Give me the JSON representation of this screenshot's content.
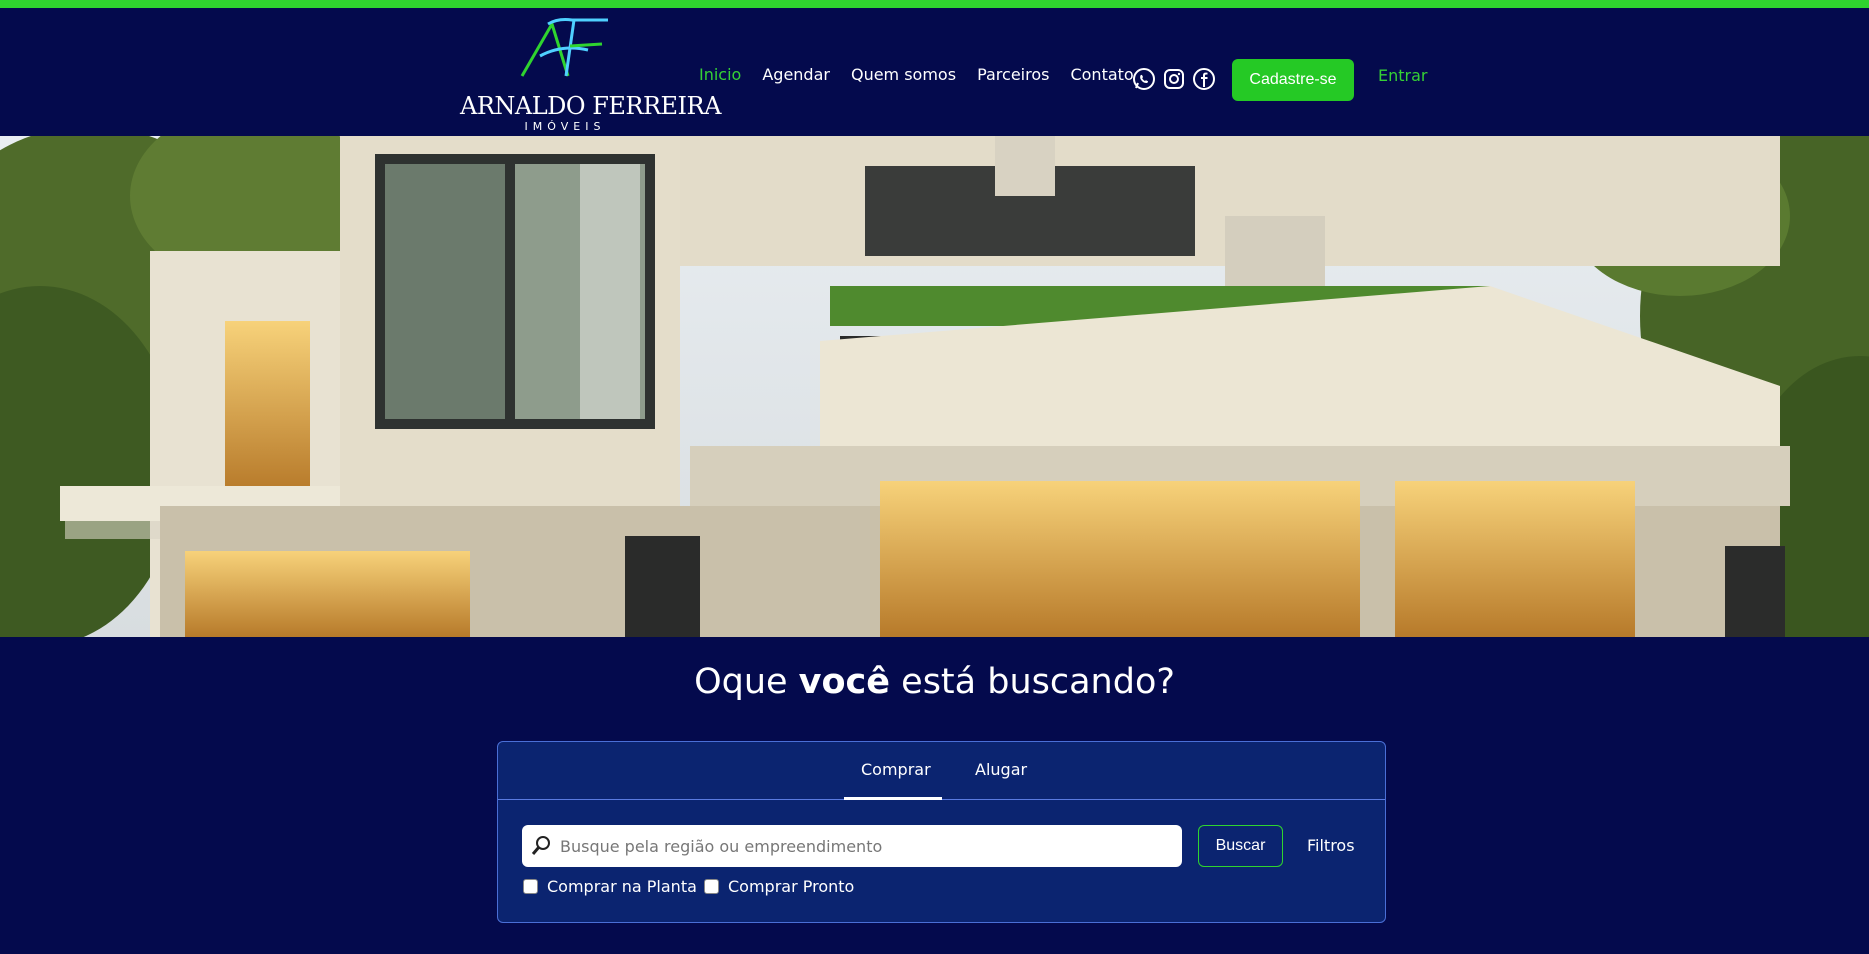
{
  "brand": {
    "name": "ARNALDO FERREIRA",
    "subtitle": "IMÓVEIS",
    "monogram": "AF"
  },
  "nav": {
    "items": [
      {
        "label": "Inicio",
        "active": true
      },
      {
        "label": "Agendar",
        "active": false
      },
      {
        "label": "Quem somos",
        "active": false
      },
      {
        "label": "Parceiros",
        "active": false
      },
      {
        "label": "Contato",
        "active": false
      }
    ],
    "socials": [
      "whatsapp-icon",
      "instagram-icon",
      "facebook-icon"
    ],
    "signup_label": "Cadastre-se",
    "login_label": "Entrar"
  },
  "hero": {
    "image": "modern-house-photo"
  },
  "search": {
    "headline_pre": "Oque ",
    "headline_bold": "você",
    "headline_post": " está buscando?",
    "tabs": [
      {
        "label": "Comprar",
        "active": true
      },
      {
        "label": "Alugar",
        "active": false
      }
    ],
    "placeholder": "Busque pela região ou empreendimento",
    "value": "",
    "search_button": "Buscar",
    "filters_button": "Filtros",
    "checkboxes": [
      {
        "label": "Comprar na Planta",
        "checked": false
      },
      {
        "label": "Comprar Pronto",
        "checked": false
      }
    ]
  },
  "colors": {
    "background": "#040a4d",
    "accent_green": "#2fd42f",
    "card": "#0b2470"
  }
}
